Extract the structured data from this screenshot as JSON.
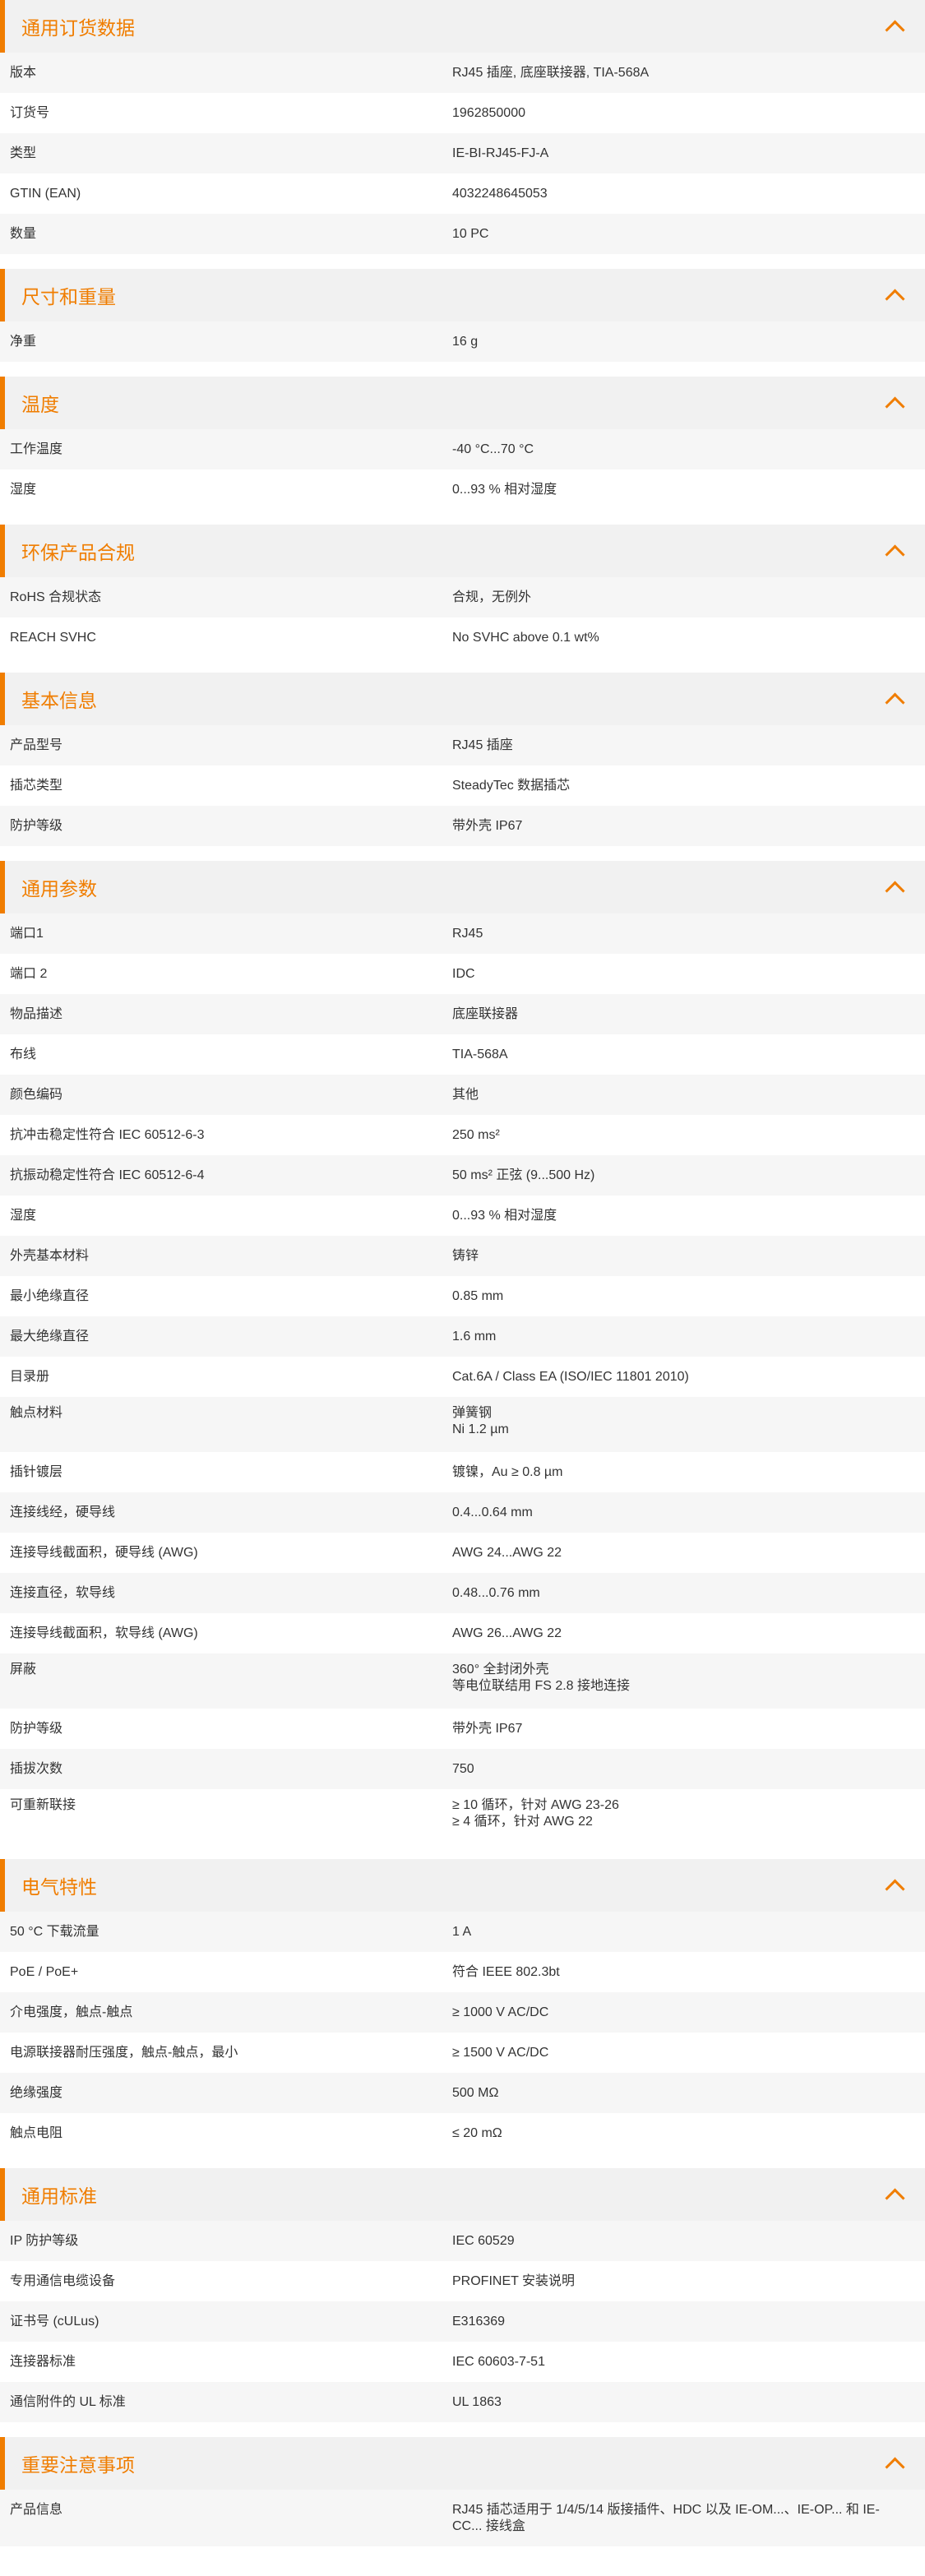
{
  "accent_color": "#f07d00",
  "sections": [
    {
      "title": "通用订货数据",
      "collapse_icon": "chevron-up-icon",
      "rows": [
        {
          "label": "版本",
          "value": "RJ45 插座, 底座联接器, TIA-568A"
        },
        {
          "label": "订货号",
          "value": "1962850000"
        },
        {
          "label": "类型",
          "value": "IE-BI-RJ45-FJ-A"
        },
        {
          "label": "GTIN (EAN)",
          "value": "4032248645053"
        },
        {
          "label": "数量",
          "value": "10  PC"
        }
      ]
    },
    {
      "title": "尺寸和重量",
      "collapse_icon": "chevron-up-icon",
      "rows": [
        {
          "label": "净重",
          "value": "16  g"
        }
      ]
    },
    {
      "title": "温度",
      "collapse_icon": "chevron-up-icon",
      "rows": [
        {
          "label": "工作温度",
          "value": "-40 °C...70 °C"
        },
        {
          "label": "湿度",
          "value": "0...93 % 相对湿度"
        }
      ]
    },
    {
      "title": "环保产品合规",
      "collapse_icon": "chevron-up-icon",
      "rows": [
        {
          "label": "RoHS 合规状态",
          "value": "合规，无例外"
        },
        {
          "label": "REACH SVHC",
          "value": "No SVHC above 0.1 wt%"
        }
      ]
    },
    {
      "title": "基本信息",
      "collapse_icon": "chevron-up-icon",
      "rows": [
        {
          "label": "产品型号",
          "value": "RJ45 插座"
        },
        {
          "label": "插芯类型",
          "value": "SteadyTec 数据插芯"
        },
        {
          "label": "防护等级",
          "value": "带外壳 IP67"
        }
      ]
    },
    {
      "title": "通用参数",
      "collapse_icon": "chevron-up-icon",
      "rows": [
        {
          "label": "端口1",
          "value": "RJ45"
        },
        {
          "label": "端口 2",
          "value": "IDC"
        },
        {
          "label": "物品描述",
          "value": "底座联接器"
        },
        {
          "label": "布线",
          "value": "TIA-568A"
        },
        {
          "label": "颜色编码",
          "value": "其他"
        },
        {
          "label": "抗冲击稳定性符合 IEC 60512-6-3",
          "value": "250 ms²"
        },
        {
          "label": "抗振动稳定性符合 IEC 60512-6-4",
          "value": "50 ms² 正弦 (9...500 Hz)"
        },
        {
          "label": "湿度",
          "value": "0...93 % 相对湿度"
        },
        {
          "label": "外壳基本材料",
          "value": "铸锌"
        },
        {
          "label": "最小绝缘直径",
          "value": "0.85  mm"
        },
        {
          "label": "最大绝缘直径",
          "value": "1.6  mm"
        },
        {
          "label": "目录册",
          "value": "Cat.6A / Class EA (ISO/IEC 11801 2010)"
        },
        {
          "label": "触点材料",
          "value": "弹簧钢\nNi 1.2 µm"
        },
        {
          "label": "插针镀层",
          "value": "镀镍，Au ≥ 0.8 µm"
        },
        {
          "label": "连接线经，硬导线",
          "value": "0.4...0.64 mm"
        },
        {
          "label": "连接导线截面积，硬导线 (AWG)",
          "value": "AWG 24...AWG 22"
        },
        {
          "label": "连接直径，软导线",
          "value": "0.48...0.76 mm"
        },
        {
          "label": "连接导线截面积，软导线 (AWG)",
          "value": "AWG 26...AWG 22"
        },
        {
          "label": "屏蔽",
          "value": "360° 全封闭外壳\n等电位联结用 FS 2.8 接地连接"
        },
        {
          "label": "防护等级",
          "value": "带外壳 IP67"
        },
        {
          "label": "插拔次数",
          "value": "750"
        },
        {
          "label": "可重新联接",
          "value": "≥ 10 循环，针对 AWG 23-26\n≥ 4 循环，针对 AWG 22"
        }
      ]
    },
    {
      "title": "电气特性",
      "collapse_icon": "chevron-up-icon",
      "rows": [
        {
          "label": "50 °C 下载流量",
          "value": "1  A"
        },
        {
          "label": "PoE / PoE+",
          "value": "符合 IEEE 802.3bt"
        },
        {
          "label": "介电强度，触点-触点",
          "value": "≥ 1000 V AC/DC"
        },
        {
          "label": "电源联接器耐压强度，触点-触点，最小",
          "value": "≥ 1500 V AC/DC"
        },
        {
          "label": "绝缘强度",
          "value": "500 MΩ"
        },
        {
          "label": "触点电阻",
          "value": "≤ 20 mΩ"
        }
      ]
    },
    {
      "title": "通用标准",
      "collapse_icon": "chevron-up-icon",
      "rows": [
        {
          "label": "IP 防护等级",
          "value": "IEC 60529"
        },
        {
          "label": "专用通信电缆设备",
          "value": "PROFINET 安装说明"
        },
        {
          "label": "证书号 (cULus)",
          "value": "E316369"
        },
        {
          "label": "连接器标准",
          "value": "IEC 60603-7-51"
        },
        {
          "label": "通信附件的 UL 标准",
          "value": "UL 1863"
        }
      ]
    },
    {
      "title": "重要注意事项",
      "collapse_icon": "chevron-up-icon",
      "rows": [
        {
          "label": "产品信息",
          "value": "RJ45 插芯适用于 1/4/5/14 版接插件、HDC 以及 IE-OM...、IE-OP... 和 IE-CC... 接线盒"
        }
      ]
    }
  ]
}
